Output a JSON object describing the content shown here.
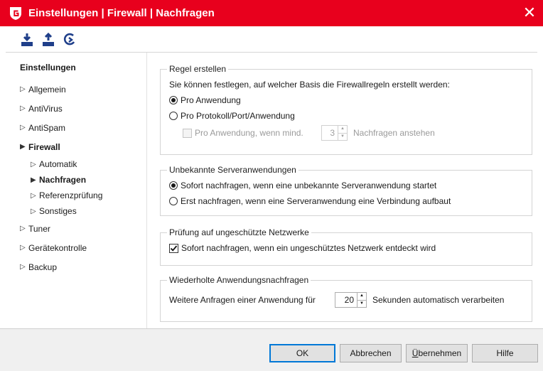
{
  "window": {
    "title": "Einstellungen | Firewall | Nachfragen",
    "accent": "#e8001d"
  },
  "toolbar": {
    "icons": [
      "import-icon",
      "export-icon",
      "reset-icon"
    ]
  },
  "sidebar": {
    "title": "Einstellungen",
    "items": [
      {
        "label": "Allgemein"
      },
      {
        "label": "AntiVirus"
      },
      {
        "label": "AntiSpam"
      },
      {
        "label": "Firewall",
        "expanded": true
      },
      {
        "label": "Automatik"
      },
      {
        "label": "Nachfragen",
        "selected": true
      },
      {
        "label": "Referenzprüfung"
      },
      {
        "label": "Sonstiges"
      },
      {
        "label": "Tuner"
      },
      {
        "label": "Gerätekontrolle"
      },
      {
        "label": "Backup"
      }
    ]
  },
  "regel": {
    "legend": "Regel erstellen",
    "description": "Sie können festlegen, auf welcher Basis die Firewallregeln erstellt werden:",
    "opt1": "Pro Anwendung",
    "opt2": "Pro Protokoll/Port/Anwendung",
    "sub_check": "Pro Anwendung, wenn mind.",
    "sub_value": "3",
    "sub_suffix": "Nachfragen anstehen",
    "selected": "opt1"
  },
  "server": {
    "legend": "Unbekannte Serveranwendungen",
    "opt1": "Sofort nachfragen, wenn eine unbekannte Serveranwendung startet",
    "opt2": "Erst nachfragen, wenn eine Serveranwendung eine Verbindung aufbaut",
    "selected": "opt1"
  },
  "netz": {
    "legend": "Prüfung auf ungeschützte Netzwerke",
    "check": "Sofort nachfragen, wenn ein ungeschütztes Netzwerk entdeckt wird",
    "checked": true
  },
  "wiederholt": {
    "legend": "Wiederholte Anwendungsnachfragen",
    "prefix": "Weitere Anfragen einer Anwendung für",
    "value": "20",
    "suffix": "Sekunden automatisch verarbeiten"
  },
  "footer": {
    "ok": "OK",
    "cancel": "Abbrechen",
    "apply_pre": "Ü",
    "apply_rest": "bernehmen",
    "help": "Hilfe"
  }
}
